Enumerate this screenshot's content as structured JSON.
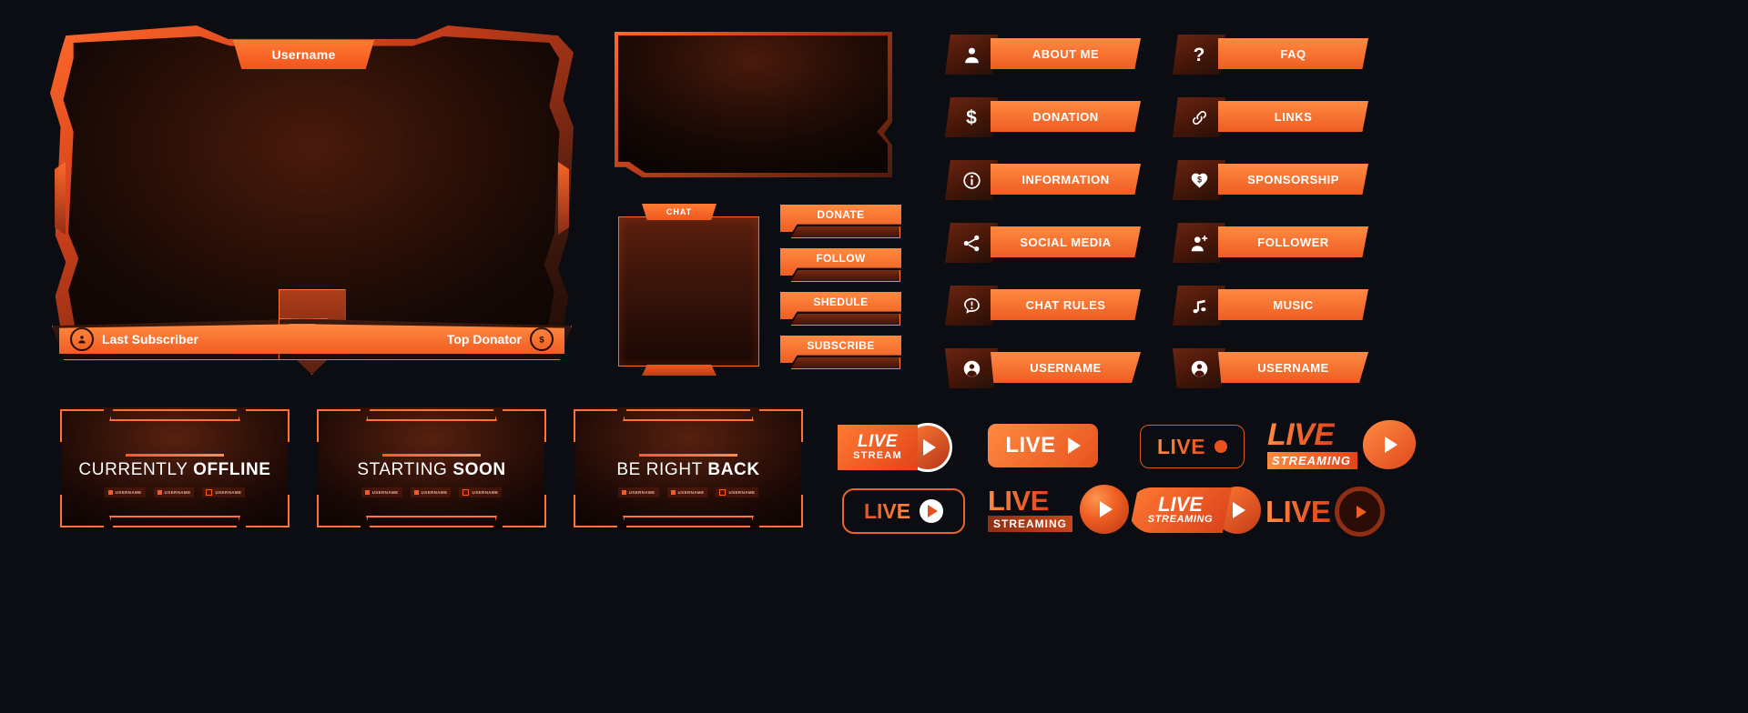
{
  "theme": {
    "background": "#0b0d12",
    "accent_orange": "#ff7a33",
    "accent_deep": "#e8521d",
    "dark_brown": "#451608"
  },
  "webcam_frame": {
    "username_label": "Username",
    "last_subscriber_label": "Last Subscriber",
    "last_subscriber_icon": "user-circle-icon",
    "top_donator_label": "Top Donator",
    "top_donator_icon": "dollar-circle-icon"
  },
  "chat_panel": {
    "tab_label": "CHAT"
  },
  "side_actions": [
    {
      "label": "DONATE"
    },
    {
      "label": "FOLLOW"
    },
    {
      "label": "SHEDULE"
    },
    {
      "label": "SUBSCRIBE"
    }
  ],
  "menu_left": [
    {
      "label": "ABOUT ME",
      "icon": "user-icon"
    },
    {
      "label": "DONATION",
      "icon": "dollar-icon"
    },
    {
      "label": "INFORMATION",
      "icon": "info-circle-icon"
    },
    {
      "label": "SOCIAL MEDIA",
      "icon": "share-icon"
    },
    {
      "label": "CHAT RULES",
      "icon": "alert-chat-icon"
    },
    {
      "label": "USERNAME",
      "icon": "user-circle-icon"
    }
  ],
  "menu_right": [
    {
      "label": "FAQ",
      "icon": "question-mark-icon"
    },
    {
      "label": "LINKS",
      "icon": "link-icon"
    },
    {
      "label": "SPONSORSHIP",
      "icon": "heart-dollar-icon"
    },
    {
      "label": "FOLLOWER",
      "icon": "user-plus-icon"
    },
    {
      "label": "MUSIC",
      "icon": "music-note-icon"
    },
    {
      "label": "USERNAME",
      "icon": "user-circle-icon"
    }
  ],
  "offline_screens": [
    {
      "title_light": "CURRENTLY",
      "title_bold": "OFFLINE",
      "tags": [
        "USERNAME",
        "USERNAME",
        "USERNAME"
      ]
    },
    {
      "title_light": "STARTING",
      "title_bold": "SOON",
      "tags": [
        "USERNAME",
        "USERNAME",
        "USERNAME"
      ]
    },
    {
      "title_light": "BE RIGHT",
      "title_bold": "BACK",
      "tags": [
        "USERNAME",
        "USERNAME",
        "USERNAME"
      ]
    }
  ],
  "live_badges": {
    "badge_1": {
      "line1": "LIVE",
      "line2": "STREAM",
      "icon": "play-ring-icon"
    },
    "badge_2": {
      "line1": "LIVE",
      "icon": "play-triangle-icon"
    },
    "badge_3": {
      "line1": "LIVE",
      "icon": "record-dot-icon"
    },
    "badge_4": {
      "line1": "LIVE",
      "line2": "STREAMING",
      "icon": "play-blob-icon"
    },
    "badge_5": {
      "line1": "LIVE",
      "icon": "play-circle-icon"
    },
    "badge_6": {
      "line1": "LIVE",
      "line2": "STREAMING",
      "icon": "play-sphere-icon"
    },
    "badge_7": {
      "line1": "LIVE",
      "line2": "STREAMING",
      "icon": "play-circle-icon"
    },
    "badge_8": {
      "line1": "LIVE",
      "icon": "play-ring-outline-icon"
    }
  }
}
